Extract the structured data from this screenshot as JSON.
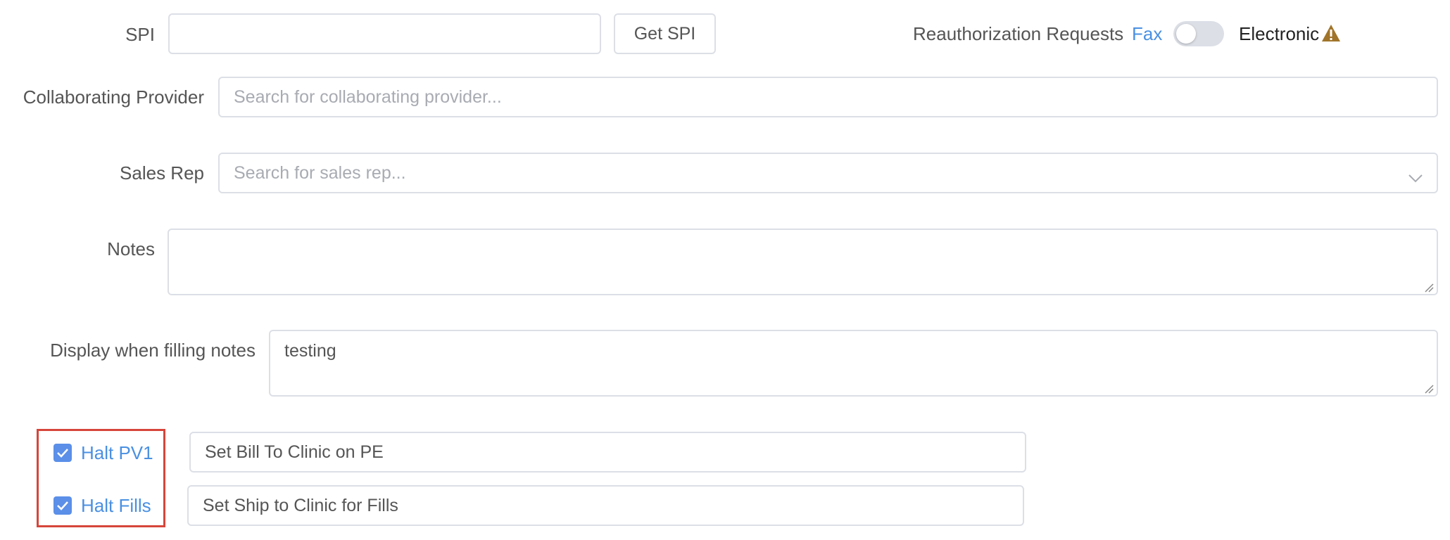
{
  "spi": {
    "label": "SPI",
    "value": "",
    "get_button": "Get SPI"
  },
  "reauth": {
    "label": "Reauthorization Requests",
    "option_left": "Fax",
    "option_right": "Electronic",
    "toggle_on": false,
    "warning_icon": "warning-icon"
  },
  "collaborating_provider": {
    "label": "Collaborating Provider",
    "placeholder": "Search for collaborating provider..."
  },
  "sales_rep": {
    "label": "Sales Rep",
    "placeholder": "Search for sales rep...",
    "icon": "chevron-down-icon"
  },
  "notes": {
    "label": "Notes",
    "value": ""
  },
  "filling_notes": {
    "label": "Display when filling notes",
    "value": "testing"
  },
  "halts": [
    {
      "label": "Halt PV1",
      "checked": true,
      "field_value": "Set Bill To Clinic on PE"
    },
    {
      "label": "Halt Fills",
      "checked": true,
      "field_value": "Set Ship to Clinic for Fills"
    }
  ],
  "colors": {
    "accent": "#4a90e2",
    "checkbox": "#5b8fe8",
    "highlight_frame": "#d6453a",
    "warning": "#a0742a"
  }
}
